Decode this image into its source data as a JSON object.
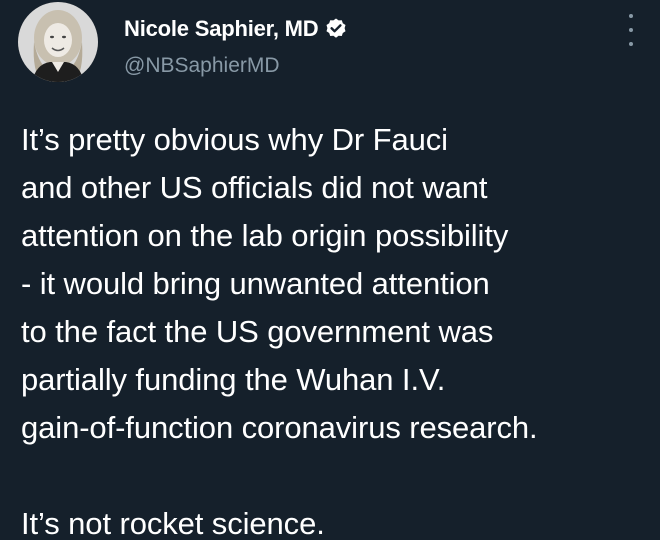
{
  "author": {
    "display_name": "Nicole Saphier, MD",
    "handle": "@NBSaphierMD",
    "verified": true,
    "avatar_icon": "profile-photo",
    "verified_icon": "verified-badge-icon"
  },
  "tweet": {
    "lines": [
      "It’s pretty obvious why Dr Fauci",
      "and other US officials did not want",
      "attention on the lab origin possibility",
      "- it would bring unwanted attention",
      "to the fact the US government was",
      "partially funding the Wuhan I.V.",
      "gain-of-function coronavirus research."
    ],
    "closing": "It’s not rocket science."
  },
  "menu": {
    "icon": "more-vertical-icon"
  },
  "colors": {
    "background": "#15202b",
    "text": "#ffffff",
    "secondary": "#8899a6",
    "verified_badge": "#ffffff"
  }
}
